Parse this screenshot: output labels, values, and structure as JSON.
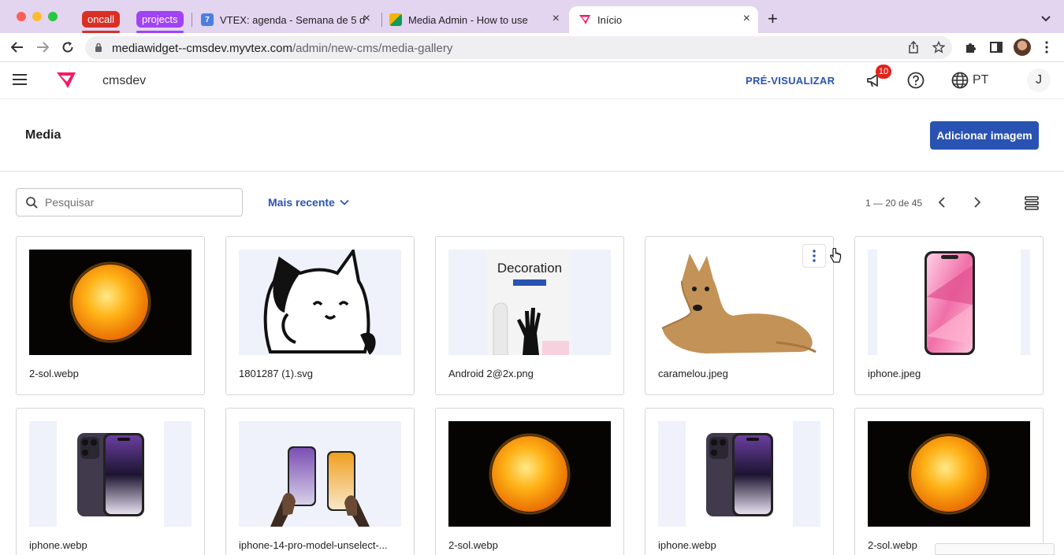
{
  "browser": {
    "tab_groups": [
      {
        "label": "oncall",
        "color": "#d93025"
      },
      {
        "label": "projects",
        "color": "#a142f4"
      }
    ],
    "tabs": [
      {
        "title": "VTEX: agenda - Semana de 5 d",
        "favicon": "calendar-icon",
        "favicon_text": "7"
      },
      {
        "title": "Media Admin - How to use",
        "favicon": "document-icon"
      },
      {
        "title": "Início",
        "favicon": "vtex-icon",
        "active": true
      }
    ],
    "url_host": "mediawidget--cmsdev.myvtex.com",
    "url_path": "/admin/new-cms/media-gallery"
  },
  "header": {
    "store_name": "cmsdev",
    "preview_label": "PRÉ-VISUALIZAR",
    "notification_count": "10",
    "language": "PT",
    "avatar_initial": "J",
    "accent_color": "#2953b2"
  },
  "page": {
    "title": "Media",
    "add_button_label": "Adicionar imagem"
  },
  "toolbar": {
    "search_placeholder": "Pesquisar",
    "sort_label": "Mais recente",
    "pagination": "1 — 20 de 45"
  },
  "media": [
    {
      "name": "2-sol.webp",
      "thumb": "sun"
    },
    {
      "name": "1801287 (1).svg",
      "thumb": "cat"
    },
    {
      "name": "Android 2@2x.png",
      "thumb": "decoration",
      "thumb_heading": "Decoration"
    },
    {
      "name": "caramelou.jpeg",
      "thumb": "dog",
      "menu_open": true
    },
    {
      "name": "iphone.jpeg",
      "thumb": "iphone-pink"
    },
    {
      "name": "iphone.webp",
      "thumb": "iphone-purple"
    },
    {
      "name": "iphone-14-pro-model-unselect-...",
      "thumb": "two-phones"
    },
    {
      "name": "2-sol.webp",
      "thumb": "sun"
    },
    {
      "name": "iphone.webp",
      "thumb": "iphone-purple"
    },
    {
      "name": "2-sol.webp",
      "thumb": "sun"
    }
  ]
}
